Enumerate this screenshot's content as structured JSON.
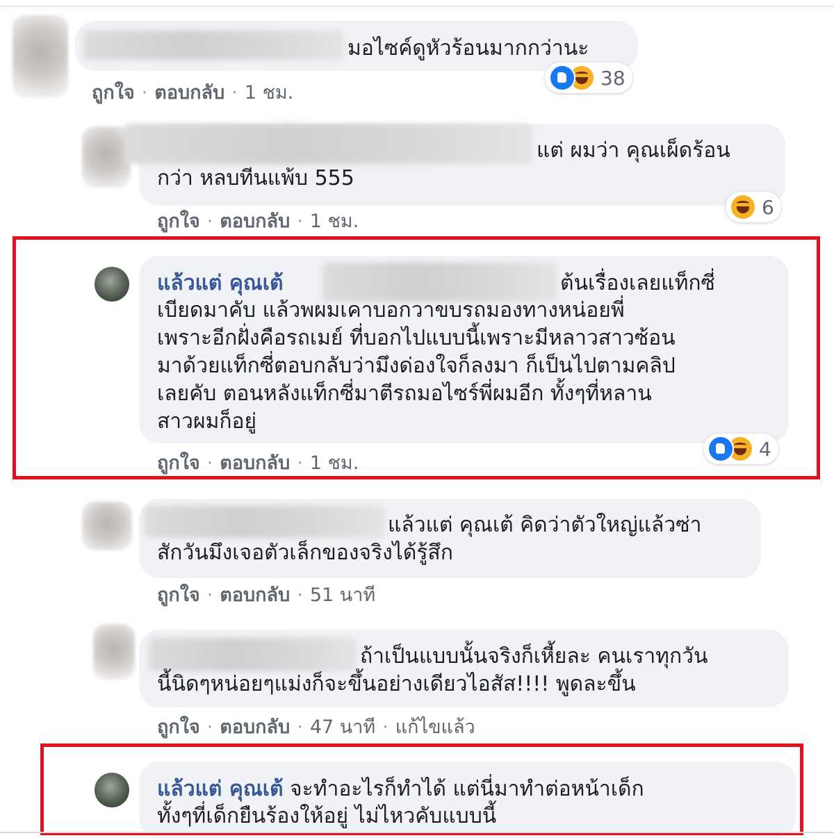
{
  "comments": [
    {
      "text": "มอไซค์ดูหัวร้อนมากกว่านะ",
      "actions": {
        "like": "ถูกใจ",
        "reply": "ตอบกลับ",
        "time": "1 ชม."
      },
      "reaction_count": "38",
      "reaction_icons": [
        "like-icon",
        "haha-icon"
      ]
    },
    {
      "text_line1": "แต่ ผมว่า คุณเผ็ดร้อน",
      "text_line2": "กว่า หลบทีนแพ้บ 555",
      "actions": {
        "like": "ถูกใจ",
        "reply": "ตอบกลับ",
        "time": "1 ชม."
      },
      "reaction_count": "6",
      "reaction_icons": [
        "haha-icon"
      ]
    },
    {
      "author": "แล้วแต่ คุณเต้",
      "line1": "ต้นเรื่องเลยแท็กซี่",
      "line2": "เบียดมาคับ แล้วพผมเคาบอกวาขบรถมองทางหน่อยพี่",
      "line3": "เพราะอีกฝั่งคือรถเมย์ ที่บอกไปแบบนี้เพราะมีหลาวสาวซ้อน",
      "line4": "มาด้วยแท็กซี่ตอบกลับว่ามึงด่องใจก็ลงมา ก็เป็นไปตามคลิป",
      "line5": "เลยคับ ตอนหลังแท็กซี่มาตีรถมอไซร์พี่ผมอีก ทั้งๆที่หลาน",
      "line6": "สาวผมก็อยู่",
      "actions": {
        "like": "ถูกใจ",
        "reply": "ตอบกลับ",
        "time": "1 ชม."
      },
      "reaction_count": "4",
      "reaction_icons": [
        "like-icon",
        "haha-icon"
      ]
    },
    {
      "line1": "แล้วแต่ คุณเต้ คิดว่าตัวใหญ่แล้วซ่า",
      "line2": "สักวันมึงเจอตัวเล็กของจริงได้รู้สึก",
      "actions": {
        "like": "ถูกใจ",
        "reply": "ตอบกลับ",
        "time": "51 นาที"
      }
    },
    {
      "line1": "ถ้าเป็นแบบนั้นจริงก็เหี้ยละ คนเราทุกวัน",
      "line2": "นี้นิดๆหน่อยๆแม่งก็จะขึ้นอย่างเดียวไอสัส!!!! พูดละขึ้น",
      "actions": {
        "like": "ถูกใจ",
        "reply": "ตอบกลับ",
        "time": "47 นาที",
        "edited": "แก้ไขแล้ว"
      }
    },
    {
      "author": "แล้วแต่ คุณเต้",
      "line1": "จะทำอะไรก็ทำได้ แต่นี่มาทำต่อหน้าเด็ก",
      "line2": "ทั้งๆที่เด็กยืนร้องให้อยู่ ไม่ไหวคับแบบนี้"
    }
  ],
  "colors": {
    "highlight": "#e0141e",
    "author": "#385898",
    "bubble": "#f0f2f5"
  }
}
